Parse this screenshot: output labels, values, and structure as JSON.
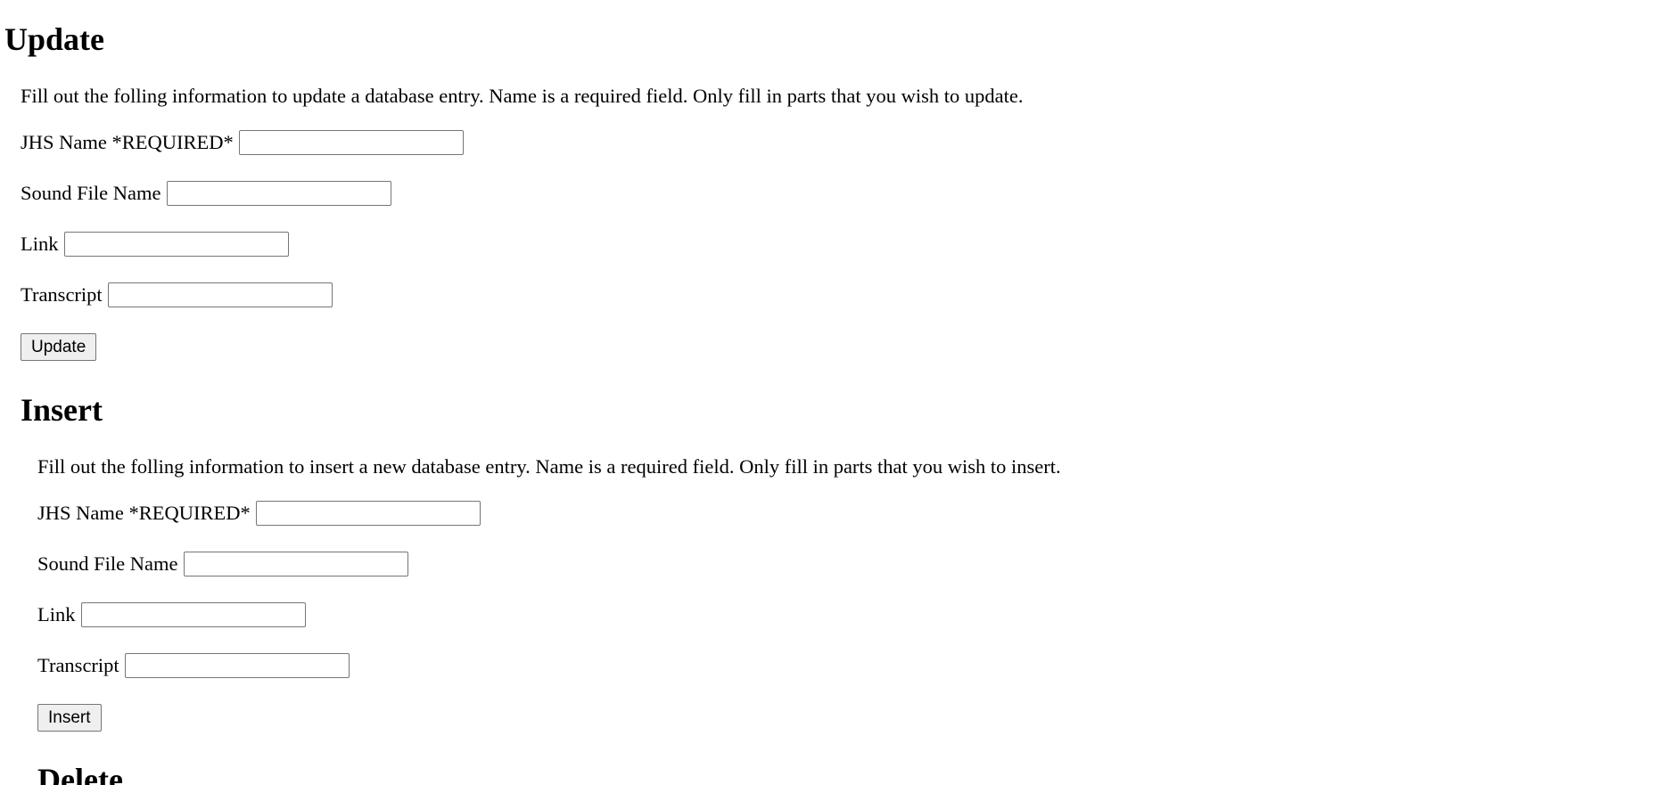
{
  "update": {
    "heading": "Update",
    "description": "Fill out the folling information to update a database entry. Name is a required field. Only fill in parts that you wish to update.",
    "fields": [
      {
        "label": "JHS Name *REQUIRED*",
        "value": "",
        "placeholder": ""
      },
      {
        "label": "Sound File Name",
        "value": "",
        "placeholder": ""
      },
      {
        "label": "Link",
        "value": "",
        "placeholder": ""
      },
      {
        "label": "Transcript",
        "value": "",
        "placeholder": ""
      }
    ],
    "button_label": "Update"
  },
  "insert": {
    "heading": "Insert",
    "description": "Fill out the folling information to insert a new database entry. Name is a required field. Only fill in parts that you wish to insert.",
    "fields": [
      {
        "label": "JHS Name *REQUIRED*",
        "value": "",
        "placeholder": ""
      },
      {
        "label": "Sound File Name",
        "value": "",
        "placeholder": ""
      },
      {
        "label": "Link",
        "value": "",
        "placeholder": ""
      },
      {
        "label": "Transcript",
        "value": "",
        "placeholder": ""
      }
    ],
    "button_label": "Insert"
  },
  "delete": {
    "heading": "Delete"
  }
}
